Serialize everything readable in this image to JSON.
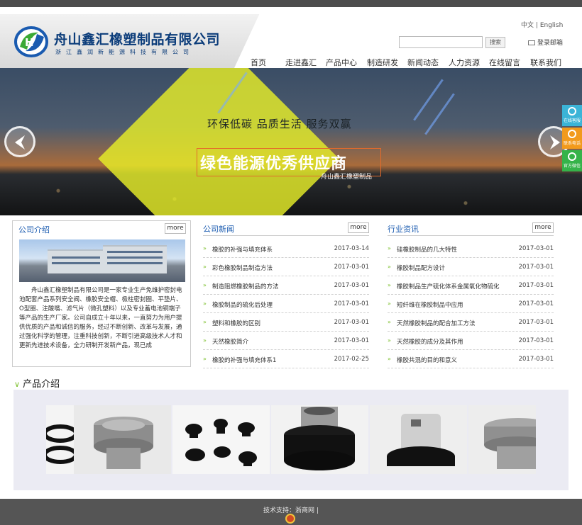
{
  "brand": {
    "company_name": "舟山鑫汇橡塑制品有限公司",
    "company_sub": "浙江鑫润新能源科技有限公司",
    "logo_colors": [
      "#1a5bb0",
      "#3aa935"
    ]
  },
  "header": {
    "lang_cn": "中文",
    "lang_sep": "|",
    "lang_en": "English",
    "search_placeholder": "",
    "search_button": "搜索",
    "mail_label": "登录邮箱"
  },
  "nav": {
    "items": [
      "首页",
      "走进鑫汇",
      "产品中心",
      "制造研发",
      "新闻动态",
      "人力资源",
      "在线留言",
      "联系我们"
    ]
  },
  "banner": {
    "slogan_top": "环保低碳 品质生活 服务双赢",
    "slogan_main": "绿色能源优秀供应商",
    "slogan_company": "舟山鑫汇橡塑制品"
  },
  "side_tools": [
    "在线客服",
    "联系电话",
    "官方微信"
  ],
  "about": {
    "title": "公司介绍",
    "more": "more",
    "text": "舟山鑫汇橡塑制品有限公司是一家专业生产免维护密封电池配套产品系列安全阀、橡胶安全帽、极柱密封圈、平垫片、O型圈、注酸嘴、滤气片（微孔塑料）以及专业蓄电池铜端子等产品的生产厂家。公司自成立十年以来，一直努力为用户提供优质的产品和诚信的服务，经过不断创新、改革与发展，通过强化科学的管理，注重科技创新，不断引进高级技术人才和更新先进技术设备，全力研制开发新产品，现已成"
  },
  "news": {
    "title": "公司新闻",
    "more": "more",
    "items": [
      {
        "title": "橡胶的补强与填充体系",
        "date": "2017-03-14"
      },
      {
        "title": "彩色橡胶制品制造方法",
        "date": "2017-03-01"
      },
      {
        "title": "制造阻燃橡胶制品的方法",
        "date": "2017-03-01"
      },
      {
        "title": "橡胶制品的硫化后处理",
        "date": "2017-03-01"
      },
      {
        "title": "塑料和橡胶的区别",
        "date": "2017-03-01"
      },
      {
        "title": "天然橡胶简介",
        "date": "2017-03-01"
      },
      {
        "title": "橡胶的补强与填充体系1",
        "date": "2017-02-25"
      }
    ]
  },
  "industry": {
    "title": "行业资讯",
    "more": "more",
    "items": [
      {
        "title": "硅橡胶制品的几大特性",
        "date": "2017-03-01"
      },
      {
        "title": "橡胶制品配方设计",
        "date": "2017-03-01"
      },
      {
        "title": "橡胶制品生产硫化体系金属氧化物硫化",
        "date": "2017-03-01"
      },
      {
        "title": "短纤维在橡胶制品中应用",
        "date": "2017-03-01"
      },
      {
        "title": "天然橡胶制品的配合加工方法",
        "date": "2017-03-01"
      },
      {
        "title": "天然橡胶的成分及其作用",
        "date": "2017-03-01"
      },
      {
        "title": "橡胶共混的目的和意义",
        "date": "2017-03-01"
      }
    ]
  },
  "products": {
    "title": "产品介绍"
  },
  "footer": {
    "support": "技术支持：浙商网 |"
  }
}
